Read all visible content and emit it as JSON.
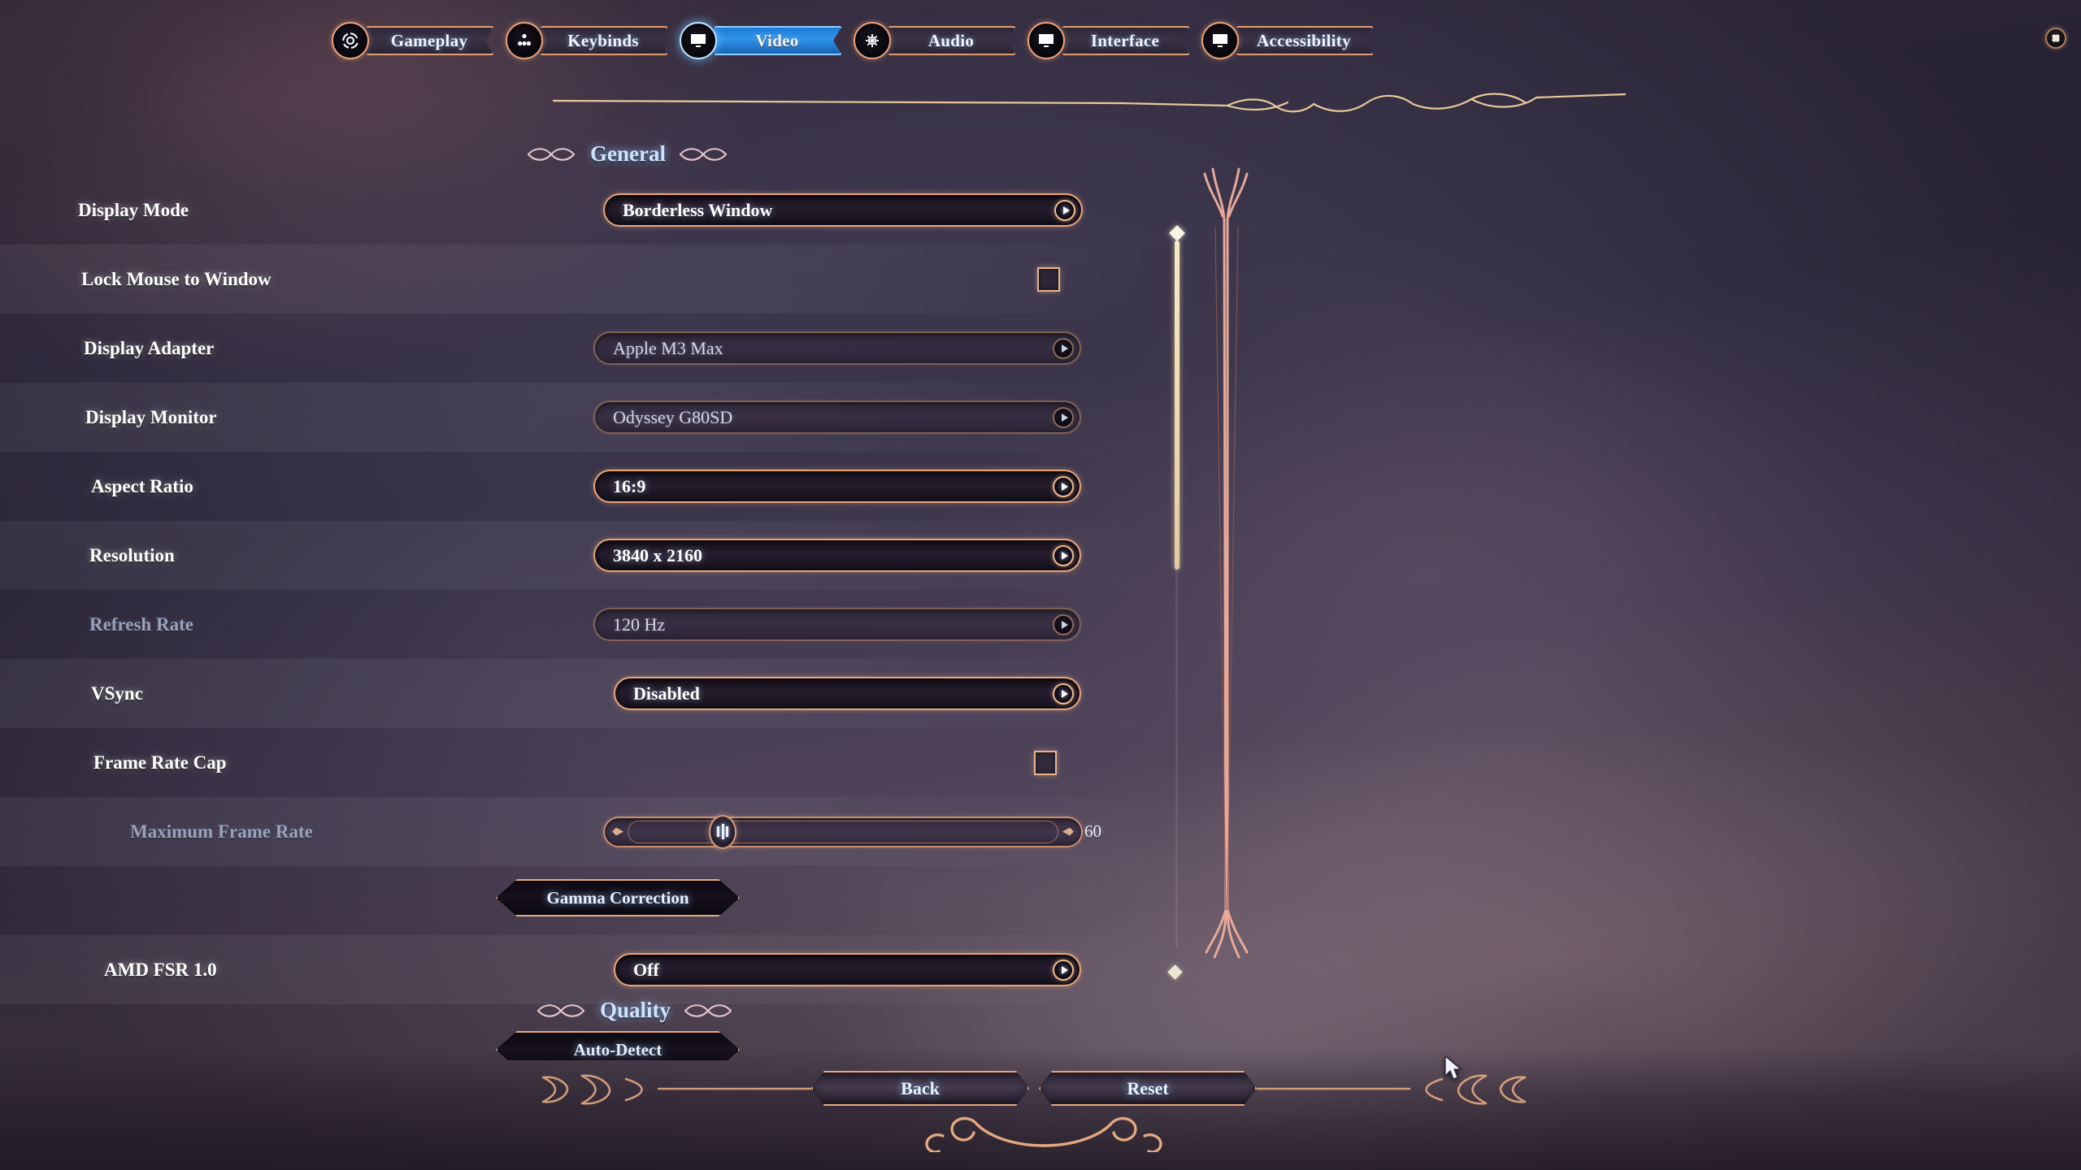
{
  "colors": {
    "accent_border": "#e6a67c",
    "active_tab": "#2f95ea",
    "title_text": "#cfe2fb",
    "label_text": "#ffffff",
    "dim_text": "#9aa2bb",
    "scrollbar": "#efdcae"
  },
  "tabs": [
    {
      "label": "Gameplay",
      "icon": "gears-icon",
      "active": false
    },
    {
      "label": "Keybinds",
      "icon": "keys-icon",
      "active": false
    },
    {
      "label": "Video",
      "icon": "monitor-icon",
      "active": true
    },
    {
      "label": "Audio",
      "icon": "speaker-icon",
      "active": false
    },
    {
      "label": "Interface",
      "icon": "monitor-icon",
      "active": false
    },
    {
      "label": "Accessibility",
      "icon": "monitor-icon",
      "active": false
    }
  ],
  "sections": {
    "general": "General",
    "quality": "Quality"
  },
  "settings": [
    {
      "label": "Display Mode",
      "type": "dropdown",
      "value": "Borderless Window",
      "dim": false
    },
    {
      "label": "Lock Mouse to Window",
      "type": "checkbox",
      "value": "",
      "dim": false,
      "checked": false
    },
    {
      "label": "Display Adapter",
      "type": "dropdown",
      "value": "Apple M3 Max",
      "dim": false
    },
    {
      "label": "Display Monitor",
      "type": "dropdown",
      "value": "Odyssey G80SD",
      "dim": false
    },
    {
      "label": "Aspect Ratio",
      "type": "dropdown",
      "value": "16:9",
      "dim": false
    },
    {
      "label": "Resolution",
      "type": "dropdown",
      "value": "3840 x 2160",
      "dim": false
    },
    {
      "label": "Refresh Rate",
      "type": "dropdown",
      "value": "120 Hz",
      "dim": true
    },
    {
      "label": "VSync",
      "type": "dropdown",
      "value": "Disabled",
      "dim": false
    },
    {
      "label": "Frame Rate Cap",
      "type": "checkbox",
      "value": "",
      "dim": false,
      "checked": false
    },
    {
      "label": "Maximum Frame Rate",
      "type": "slider",
      "value": "60",
      "dim": true
    },
    {
      "label": "",
      "type": "button",
      "value": "Gamma Correction",
      "dim": false
    },
    {
      "label": "AMD FSR 1.0",
      "type": "dropdown",
      "value": "Off",
      "dim": false
    }
  ],
  "quality_section": {
    "auto_detect_label": "Auto-Detect"
  },
  "scrollbar": {
    "position_label": ""
  },
  "footer": {
    "back_label": "Back",
    "reset_label": "Reset"
  }
}
